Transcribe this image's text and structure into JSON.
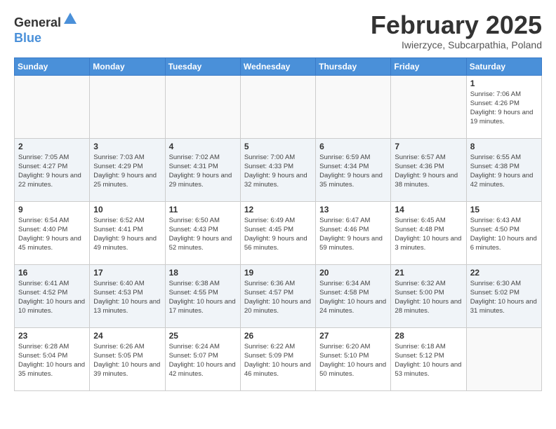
{
  "header": {
    "logo_general": "General",
    "logo_blue": "Blue",
    "month": "February 2025",
    "location": "Iwierzyce, Subcarpathia, Poland"
  },
  "weekdays": [
    "Sunday",
    "Monday",
    "Tuesday",
    "Wednesday",
    "Thursday",
    "Friday",
    "Saturday"
  ],
  "weeks": [
    [
      {
        "day": "",
        "info": ""
      },
      {
        "day": "",
        "info": ""
      },
      {
        "day": "",
        "info": ""
      },
      {
        "day": "",
        "info": ""
      },
      {
        "day": "",
        "info": ""
      },
      {
        "day": "",
        "info": ""
      },
      {
        "day": "1",
        "info": "Sunrise: 7:06 AM\nSunset: 4:26 PM\nDaylight: 9 hours\nand 19 minutes."
      }
    ],
    [
      {
        "day": "2",
        "info": "Sunrise: 7:05 AM\nSunset: 4:27 PM\nDaylight: 9 hours\nand 22 minutes."
      },
      {
        "day": "3",
        "info": "Sunrise: 7:03 AM\nSunset: 4:29 PM\nDaylight: 9 hours\nand 25 minutes."
      },
      {
        "day": "4",
        "info": "Sunrise: 7:02 AM\nSunset: 4:31 PM\nDaylight: 9 hours\nand 29 minutes."
      },
      {
        "day": "5",
        "info": "Sunrise: 7:00 AM\nSunset: 4:33 PM\nDaylight: 9 hours\nand 32 minutes."
      },
      {
        "day": "6",
        "info": "Sunrise: 6:59 AM\nSunset: 4:34 PM\nDaylight: 9 hours\nand 35 minutes."
      },
      {
        "day": "7",
        "info": "Sunrise: 6:57 AM\nSunset: 4:36 PM\nDaylight: 9 hours\nand 38 minutes."
      },
      {
        "day": "8",
        "info": "Sunrise: 6:55 AM\nSunset: 4:38 PM\nDaylight: 9 hours\nand 42 minutes."
      }
    ],
    [
      {
        "day": "9",
        "info": "Sunrise: 6:54 AM\nSunset: 4:40 PM\nDaylight: 9 hours\nand 45 minutes."
      },
      {
        "day": "10",
        "info": "Sunrise: 6:52 AM\nSunset: 4:41 PM\nDaylight: 9 hours\nand 49 minutes."
      },
      {
        "day": "11",
        "info": "Sunrise: 6:50 AM\nSunset: 4:43 PM\nDaylight: 9 hours\nand 52 minutes."
      },
      {
        "day": "12",
        "info": "Sunrise: 6:49 AM\nSunset: 4:45 PM\nDaylight: 9 hours\nand 56 minutes."
      },
      {
        "day": "13",
        "info": "Sunrise: 6:47 AM\nSunset: 4:46 PM\nDaylight: 9 hours\nand 59 minutes."
      },
      {
        "day": "14",
        "info": "Sunrise: 6:45 AM\nSunset: 4:48 PM\nDaylight: 10 hours\nand 3 minutes."
      },
      {
        "day": "15",
        "info": "Sunrise: 6:43 AM\nSunset: 4:50 PM\nDaylight: 10 hours\nand 6 minutes."
      }
    ],
    [
      {
        "day": "16",
        "info": "Sunrise: 6:41 AM\nSunset: 4:52 PM\nDaylight: 10 hours\nand 10 minutes."
      },
      {
        "day": "17",
        "info": "Sunrise: 6:40 AM\nSunset: 4:53 PM\nDaylight: 10 hours\nand 13 minutes."
      },
      {
        "day": "18",
        "info": "Sunrise: 6:38 AM\nSunset: 4:55 PM\nDaylight: 10 hours\nand 17 minutes."
      },
      {
        "day": "19",
        "info": "Sunrise: 6:36 AM\nSunset: 4:57 PM\nDaylight: 10 hours\nand 20 minutes."
      },
      {
        "day": "20",
        "info": "Sunrise: 6:34 AM\nSunset: 4:58 PM\nDaylight: 10 hours\nand 24 minutes."
      },
      {
        "day": "21",
        "info": "Sunrise: 6:32 AM\nSunset: 5:00 PM\nDaylight: 10 hours\nand 28 minutes."
      },
      {
        "day": "22",
        "info": "Sunrise: 6:30 AM\nSunset: 5:02 PM\nDaylight: 10 hours\nand 31 minutes."
      }
    ],
    [
      {
        "day": "23",
        "info": "Sunrise: 6:28 AM\nSunset: 5:04 PM\nDaylight: 10 hours\nand 35 minutes."
      },
      {
        "day": "24",
        "info": "Sunrise: 6:26 AM\nSunset: 5:05 PM\nDaylight: 10 hours\nand 39 minutes."
      },
      {
        "day": "25",
        "info": "Sunrise: 6:24 AM\nSunset: 5:07 PM\nDaylight: 10 hours\nand 42 minutes."
      },
      {
        "day": "26",
        "info": "Sunrise: 6:22 AM\nSunset: 5:09 PM\nDaylight: 10 hours\nand 46 minutes."
      },
      {
        "day": "27",
        "info": "Sunrise: 6:20 AM\nSunset: 5:10 PM\nDaylight: 10 hours\nand 50 minutes."
      },
      {
        "day": "28",
        "info": "Sunrise: 6:18 AM\nSunset: 5:12 PM\nDaylight: 10 hours\nand 53 minutes."
      },
      {
        "day": "",
        "info": ""
      }
    ]
  ]
}
